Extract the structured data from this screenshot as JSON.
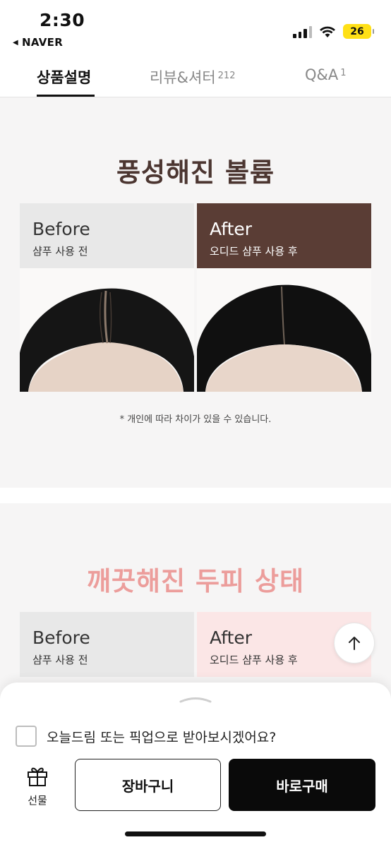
{
  "status": {
    "time": "2:30",
    "back_app": "NAVER",
    "battery": "26"
  },
  "tabs": [
    {
      "label": "상품설명",
      "count": ""
    },
    {
      "label": "리뷰&셔터",
      "count": "212"
    },
    {
      "label": "Q&A",
      "count": "1"
    }
  ],
  "section1": {
    "title": "풍성해진 볼륨",
    "before": {
      "en": "Before",
      "ko": "샴푸 사용 전"
    },
    "after": {
      "en": "After",
      "ko": "오디드 샴푸 사용 후"
    },
    "note": "* 개인에 따라 차이가 있을 수 있습니다."
  },
  "section2": {
    "title": "깨끗해진 두피 상태",
    "before": {
      "en": "Before",
      "ko": "샴푸 사용 전"
    },
    "after": {
      "en": "After",
      "ko": "오디드 샴푸 사용 후"
    }
  },
  "sheet": {
    "checkbox_label": "오늘드림 또는 픽업으로 받아보시겠어요?",
    "checkbox_checked": false,
    "gift_label": "선물",
    "cart_label": "장바구니",
    "buy_label": "바로구매"
  },
  "colors": {
    "heading_brown": "#4c3631",
    "after_brown": "#5a3d35",
    "heading_pink": "#ec9d9b",
    "after_pink": "#fbe6e6"
  },
  "icons": [
    "back-arrow-icon",
    "signal-icon",
    "wifi-icon",
    "battery-icon",
    "arrow-up-icon",
    "sheet-handle-icon",
    "gift-icon"
  ]
}
